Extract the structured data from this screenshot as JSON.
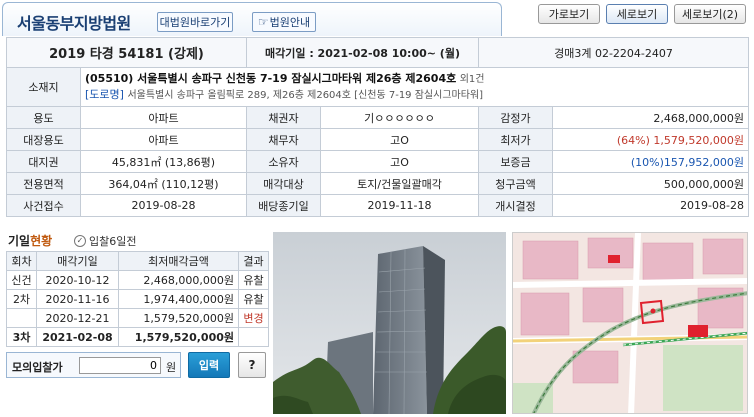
{
  "header": {
    "court_name": "서울동부지방법원",
    "supreme_court_link": "대법원바로가기",
    "court_guide_link": "법원안내"
  },
  "view_buttons": {
    "landscape": "가로보기",
    "portrait": "세로보기",
    "portrait2": "세로보기(2)"
  },
  "case": {
    "case_no": "2019 타경 54181 (강제)",
    "sale_date": "매각기일 : 2021-02-08 10:00~ (월)",
    "department": "경매3계 02-2204-2407"
  },
  "address": {
    "label": "소재지",
    "main": "(05510) 서울특별시 송파구 신천동 7-19 잠실시그마타워 제26층 제2604호",
    "extra": "외1건",
    "road_tag": "[도로명]",
    "road": "서울특별시 송파구 올림픽로 289, 제26층 제2604호 [신천동 7-19 잠실시그마타워]"
  },
  "details": {
    "r1": {
      "l1": "용도",
      "v1": "아파트",
      "l2": "채권자",
      "v2": "기ㅇㅇㅇㅇㅇㅇ",
      "l3": "감정가",
      "v3": "2,468,000,000원"
    },
    "r2": {
      "l1": "대장용도",
      "v1": "아파트",
      "l2": "채무자",
      "v2": "고O",
      "l3": "최저가",
      "v3": "(64%) 1,579,520,000원"
    },
    "r3": {
      "l1": "대지권",
      "v1": "45,831㎡ (13,86평)",
      "l2": "소유자",
      "v2": "고O",
      "l3": "보증금",
      "v3": "(10%)157,952,000원"
    },
    "r4": {
      "l1": "전용면적",
      "v1": "364,04㎡ (110,12평)",
      "l2": "매각대상",
      "v2": "토지/건물일괄매각",
      "l3": "청구금액",
      "v3": "500,000,000원"
    },
    "r5": {
      "l1": "사건접수",
      "v1": "2019-08-28",
      "l2": "배당종기일",
      "v2": "2019-11-18",
      "l3": "개시결정",
      "v3": "2019-08-28"
    }
  },
  "history": {
    "title_a": "기일",
    "title_b": "현황",
    "bid_days": "입찰6일전",
    "headers": [
      "회차",
      "매각기일",
      "최저매각금액",
      "결과"
    ],
    "rows": [
      {
        "round": "신건",
        "date": "2020-10-12",
        "price": "2,468,000,000원",
        "result": "유찰"
      },
      {
        "round": "2차",
        "date": "2020-11-16",
        "price": "1,974,400,000원",
        "result": "유찰"
      },
      {
        "round": "",
        "date": "2020-12-21",
        "price": "1,579,520,000원",
        "result": "변경"
      },
      {
        "round": "3차",
        "date": "2021-02-08",
        "price": "1,579,520,000원",
        "result": ""
      }
    ]
  },
  "mock_bid": {
    "label": "모의입찰가",
    "value": "0",
    "unit": "원",
    "submit": "입력",
    "help": "?"
  },
  "colors": {
    "title_blue": "#1a3f73",
    "label_bg": "#eef2f7",
    "border": "#c4ccd6",
    "red": "#c0392b",
    "link_blue": "#1a56b0",
    "enter_button": "#1a8bc8"
  }
}
